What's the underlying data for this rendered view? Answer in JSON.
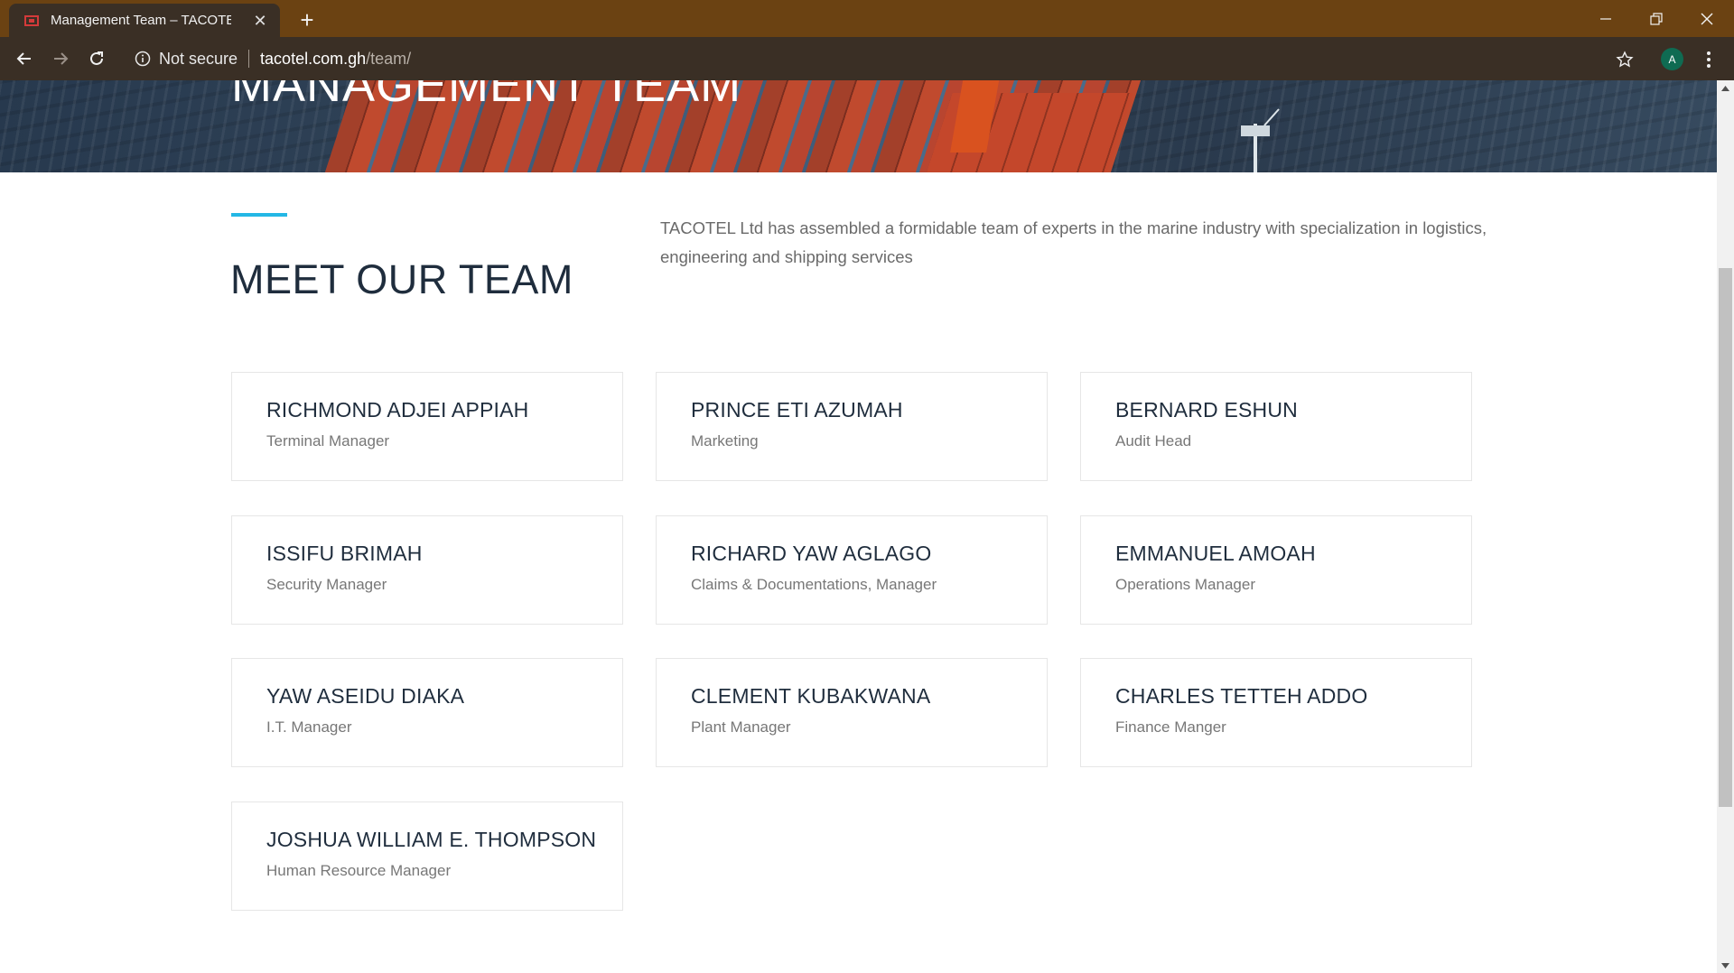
{
  "browser": {
    "tab_title": "Management Team – TACOTEL",
    "security_label": "Not secure",
    "url_host": "tacotel.com.gh",
    "url_path": "/team/",
    "profile_initial": "A",
    "icons": {
      "favicon": "tacotel-favicon-icon",
      "close_tab": "close-icon",
      "new_tab": "plus-icon",
      "back": "arrow-left-icon",
      "forward": "arrow-right-icon",
      "reload": "reload-icon",
      "info": "info-icon",
      "bookmark": "star-icon",
      "menu": "more-vert-icon",
      "minimize": "minimize-icon",
      "restore": "restore-icon",
      "close_window": "close-icon"
    },
    "colors": {
      "frame": "#6b4212",
      "toolbar": "#3a2f25",
      "avatar": "#0f6b52"
    }
  },
  "hero": {
    "title": "MANAGEMENT TEAM"
  },
  "section": {
    "title": "MEET OUR TEAM",
    "intro": "TACOTEL Ltd has assembled a formidable team of experts in the marine industry with specialization in logistics, engineering and shipping services",
    "accent_color": "#23b7e5"
  },
  "team": [
    {
      "name": "RICHMOND ADJEI APPIAH",
      "role": "Terminal Manager"
    },
    {
      "name": "PRINCE ETI AZUMAH",
      "role": "Marketing"
    },
    {
      "name": "BERNARD ESHUN",
      "role": "Audit Head"
    },
    {
      "name": "ISSIFU BRIMAH",
      "role": "Security Manager"
    },
    {
      "name": "RICHARD YAW AGLAGO",
      "role": "Claims & Documentations, Manager"
    },
    {
      "name": "EMMANUEL AMOAH",
      "role": "Operations Manager"
    },
    {
      "name": "YAW ASEIDU DIAKA",
      "role": "I.T. Manager"
    },
    {
      "name": "CLEMENT KUBAKWANA",
      "role": "Plant Manager"
    },
    {
      "name": "CHARLES TETTEH ADDO",
      "role": "Finance Manger"
    },
    {
      "name": "JOSHUA WILLIAM E. THOMPSON",
      "role": "Human Resource Manager"
    }
  ]
}
